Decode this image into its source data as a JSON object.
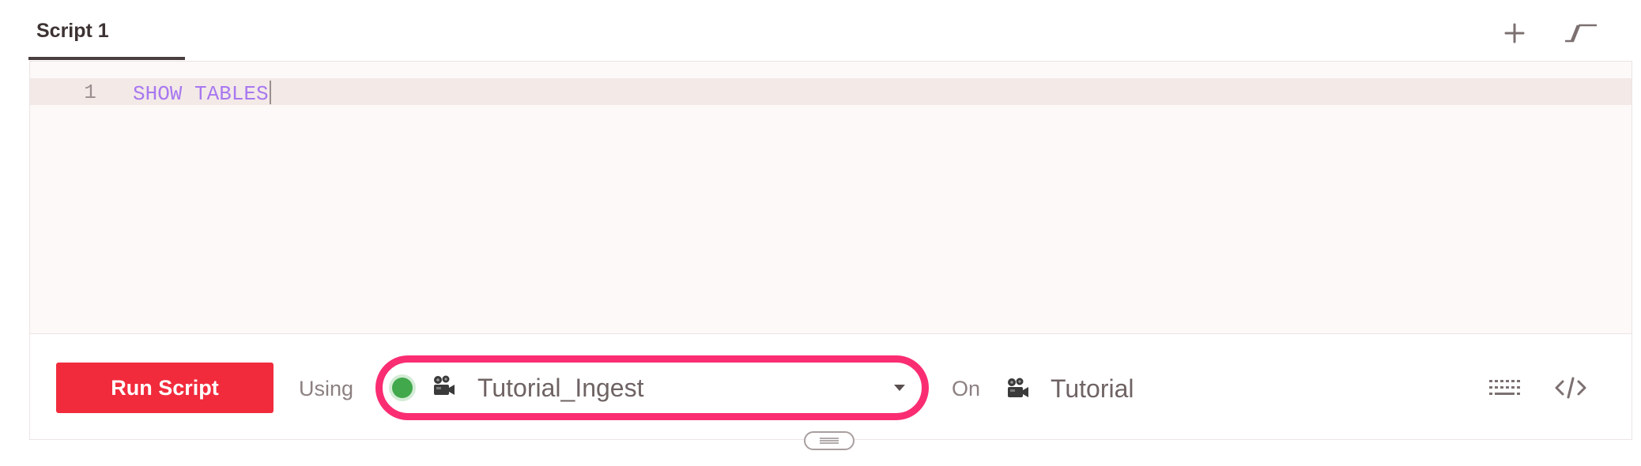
{
  "tabs": [
    {
      "label": "Script 1",
      "active": true
    }
  ],
  "toolbar": {
    "add_icon": "plus-icon",
    "collapse_icon": "collapse-panel-icon"
  },
  "editor": {
    "lines": [
      {
        "number": "1",
        "text": "SHOW TABLES"
      }
    ],
    "keyword_color": "#a878f0"
  },
  "footer": {
    "run_label": "Run Script",
    "run_color": "#f12b3c",
    "using_label": "Using",
    "pipeline": {
      "value": "Tutorial_Ingest",
      "status": "running",
      "status_color": "#41a84c",
      "icon": "film-camera-icon",
      "highlight_color": "#fa2d73"
    },
    "on_label": "On",
    "team": {
      "value": "Tutorial",
      "icon": "film-camera-icon"
    },
    "keyboard_icon": "keyboard-icon",
    "code_icon": "code-brackets-icon"
  },
  "resize_icon": "drag-handle-icon"
}
